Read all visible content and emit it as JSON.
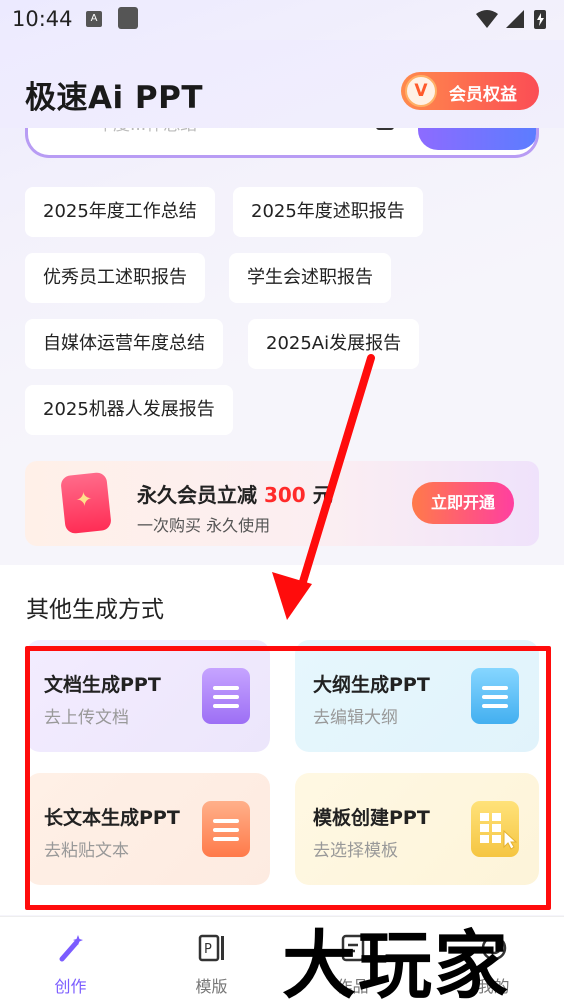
{
  "status_bar": {
    "time": "10:44",
    "notif_icon_letter": "A"
  },
  "header": {
    "title": "极速Ai PPT",
    "vip_badge": "V",
    "vip_label": "会员权益"
  },
  "search": {
    "placeholder_fragment": "年度...作总结"
  },
  "chips": [
    "2025年度工作总结",
    "2025年度述职报告",
    "优秀员工述职报告",
    "学生会述职报告",
    "自媒体运营年度总结",
    "2025Ai发展报告",
    "2025机器人发展报告"
  ],
  "promo": {
    "title_prefix": "永久会员立减",
    "amount": "300",
    "unit": "元",
    "subtitle": "一次购买 永久使用",
    "button": "立即开通"
  },
  "section": {
    "title": "其他生成方式",
    "cards": [
      {
        "title": "文档生成PPT",
        "subtitle": "去上传文档",
        "icon": "document-icon",
        "color": "#a67cf7"
      },
      {
        "title": "大纲生成PPT",
        "subtitle": "去编辑大纲",
        "icon": "outline-icon",
        "color": "#4fb8f4"
      },
      {
        "title": "长文本生成PPT",
        "subtitle": "去粘贴文本",
        "icon": "text-icon",
        "color": "#ff8a5b"
      },
      {
        "title": "模板创建PPT",
        "subtitle": "去选择模板",
        "icon": "template-icon",
        "color": "#f5c94a"
      }
    ]
  },
  "nav": [
    {
      "label": "创作",
      "icon": "magic-wand-icon",
      "active": true
    },
    {
      "label": "模版",
      "icon": "ppt-template-icon",
      "active": false
    },
    {
      "label": "作品",
      "icon": "works-icon",
      "active": false
    },
    {
      "label": "我的",
      "icon": "profile-icon",
      "active": false
    }
  ],
  "watermark": "大玩家",
  "annotation_color": "#ff0c0c"
}
